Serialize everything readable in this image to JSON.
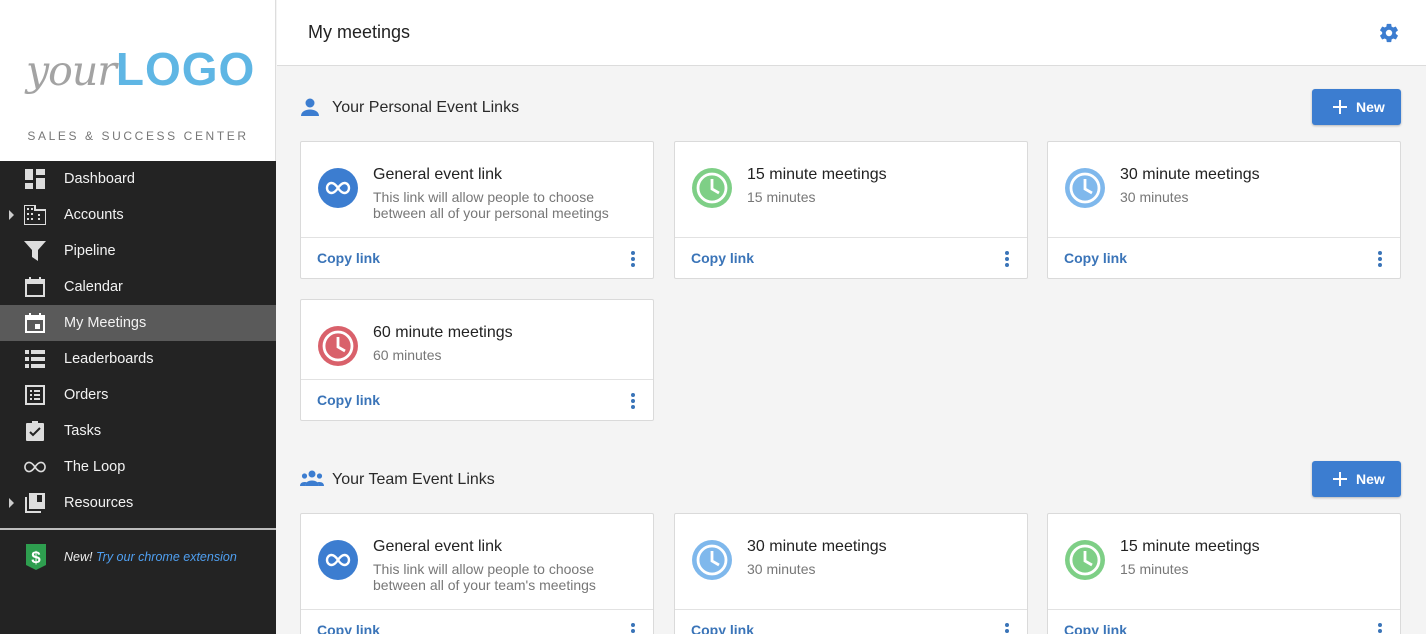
{
  "brand": {
    "logo_your": "your",
    "logo_logo": "LOGO",
    "tagline": "SALES & SUCCESS CENTER"
  },
  "nav": [
    {
      "label": "Dashboard",
      "icon": "dashboard-icon"
    },
    {
      "label": "Accounts",
      "icon": "building-icon",
      "expandable": true
    },
    {
      "label": "Pipeline",
      "icon": "filter-icon"
    },
    {
      "label": "Calendar",
      "icon": "calendar-icon"
    },
    {
      "label": "My Meetings",
      "icon": "event-icon",
      "active": true
    },
    {
      "label": "Leaderboards",
      "icon": "list-icon"
    },
    {
      "label": "Orders",
      "icon": "receipt-icon"
    },
    {
      "label": "Tasks",
      "icon": "clipboard-check-icon"
    },
    {
      "label": "The Loop",
      "icon": "infinity-icon"
    },
    {
      "label": "Resources",
      "icon": "library-icon",
      "expandable": true
    }
  ],
  "extension": {
    "new_label": "New!",
    "link_label": "Try our chrome extension"
  },
  "header": {
    "title": "My meetings"
  },
  "colors": {
    "accent": "#3c7dd0",
    "infinity": "#3c7dd0",
    "green": "#7ecf86",
    "light_blue": "#7fb8ec",
    "red": "#d9616b",
    "sidebar_bg": "#232323",
    "active_bg": "#5a5a5a"
  },
  "sections": [
    {
      "title": "Your Personal Event Links",
      "icon": "person-icon",
      "new_label": "New",
      "cards": [
        {
          "title": "General event link",
          "desc": "This link will allow people to choose between all of your personal meetings",
          "icon": "infinity",
          "copy": "Copy link"
        },
        {
          "title": "15 minute meetings",
          "desc": "15 minutes",
          "icon": "clock-green",
          "copy": "Copy link"
        },
        {
          "title": "30 minute meetings",
          "desc": "30 minutes",
          "icon": "clock-blue",
          "copy": "Copy link"
        },
        {
          "title": "60 minute meetings",
          "desc": "60 minutes",
          "icon": "clock-red",
          "copy": "Copy link"
        }
      ]
    },
    {
      "title": "Your Team Event Links",
      "icon": "group-icon",
      "new_label": "New",
      "cards": [
        {
          "title": "General event link",
          "desc": "This link will allow people to choose between all of your team's meetings",
          "icon": "infinity",
          "copy": "Copy link"
        },
        {
          "title": "30 minute meetings",
          "desc": "30 minutes",
          "icon": "clock-blue",
          "copy": "Copy link"
        },
        {
          "title": "15 minute meetings",
          "desc": "15 minutes",
          "icon": "clock-green",
          "copy": "Copy link"
        }
      ]
    }
  ]
}
